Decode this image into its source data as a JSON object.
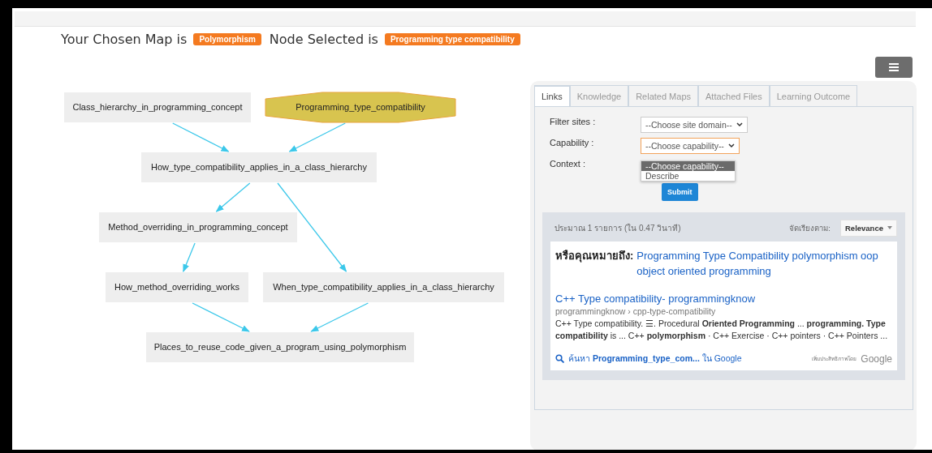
{
  "header": {
    "map_label": "Your Chosen Map is",
    "map": "Polymorphism",
    "node_label": "Node Selected is",
    "node": "Programming type compatibility"
  },
  "graph": {
    "nodes": [
      {
        "label": "Class_hierarchy_in_programming_concept",
        "selected": false
      },
      {
        "label": "Programming_type_compatibility",
        "selected": true
      },
      {
        "label": "How_type_compatibility_applies_in_a_class_hierarchy",
        "selected": false
      },
      {
        "label": "Method_overriding_in_programming_concept",
        "selected": false
      },
      {
        "label": "How_method_overriding_works",
        "selected": false
      },
      {
        "label": "When_type_compatibility_applies_in_a_class_hierarchy",
        "selected": false
      },
      {
        "label": "Places_to_reuse_code_given_a_program_using_polymorphism",
        "selected": false
      }
    ]
  },
  "panel": {
    "tabs": [
      {
        "label": "Links",
        "selected": true
      },
      {
        "label": "Knowledge",
        "selected": false
      },
      {
        "label": "Related Maps",
        "selected": false
      },
      {
        "label": "Attached Files",
        "selected": false
      },
      {
        "label": "Learning Outcome",
        "selected": false
      }
    ],
    "form": {
      "filter_label": "Filter sites :",
      "filter_value": "--Choose site domain--",
      "capability_label": "Capability :",
      "capability_value": "--Choose capability--",
      "capability_expanded": true,
      "capability_options": [
        {
          "label": "--Choose capability--",
          "selected": true
        },
        {
          "label": "Describe",
          "selected": false
        }
      ],
      "context_label": "Context :",
      "submit": "Submit"
    },
    "results": {
      "stats": "ประมาณ 1 รายการ (ใน 0.47 วินาที)",
      "sort_label": "จัดเรียงตาม:",
      "sort_value": "Relevance",
      "did_you_mean_label": "หรือคุณหมายถึง:",
      "did_you_mean": "Programming Type Compatibility polymorphism oop object oriented programming",
      "items": [
        {
          "title": "C++ Type compatibility- programmingknow",
          "url": "programmingknow › cpp-type-compatibility",
          "snippet": "C++ Type compatibility. ☰. Procedural **Oriented Programming** ... **programming. Type compatibility** is ... C++ **polymorphism** · C++ Exercise · C++ pointers · C++ Pointers ..."
        }
      ],
      "footer": {
        "search_link": "ค้นหา **Programming_type_com...** ใน Google",
        "enhanced_by": "เพิ่มประสิทธิภาพโดย",
        "brand": "Google"
      }
    }
  }
}
